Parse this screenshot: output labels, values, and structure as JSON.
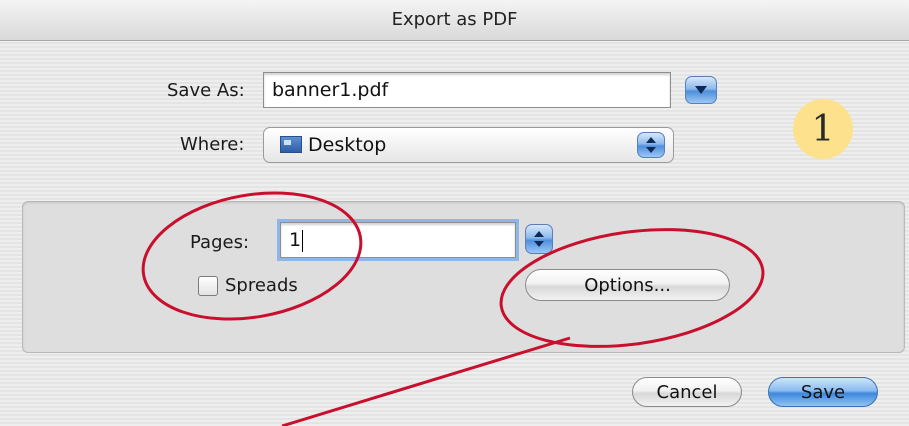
{
  "dialog": {
    "title": "Export as PDF"
  },
  "save_as": {
    "label": "Save As:",
    "value": "banner1.pdf"
  },
  "where": {
    "label": "Where:",
    "selected": "Desktop"
  },
  "pages": {
    "label": "Pages:",
    "value": "1"
  },
  "spreads": {
    "label": "Spreads",
    "checked": false
  },
  "buttons": {
    "options": "Options...",
    "cancel": "Cancel",
    "save": "Save"
  },
  "annotation": {
    "step_number": "1",
    "highlight_color": "#c8102e",
    "badge_color": "#fde18d"
  },
  "colors": {
    "accent": "#3f87dc"
  }
}
